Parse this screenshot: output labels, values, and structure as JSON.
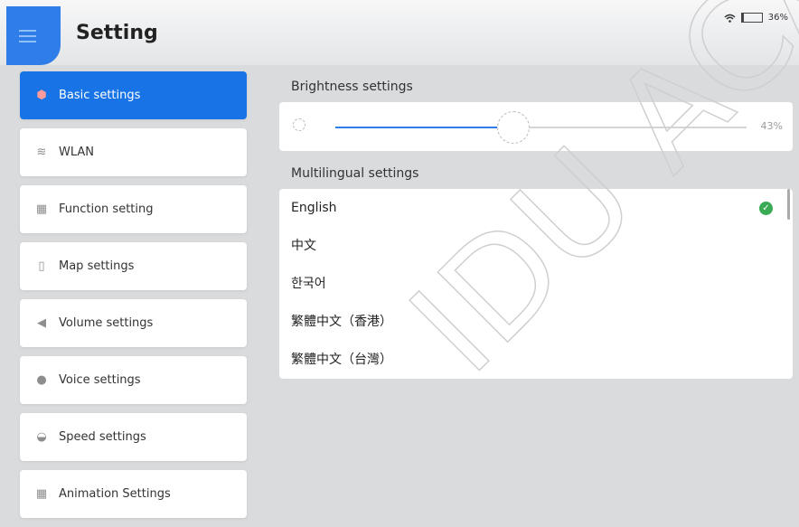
{
  "header": {
    "title": "Setting",
    "battery": "36%"
  },
  "sidebar": {
    "items": [
      {
        "label": "Basic settings",
        "icon": "gear-icon"
      },
      {
        "label": "WLAN",
        "icon": "wifi-icon"
      },
      {
        "label": "Function setting",
        "icon": "grid-icon"
      },
      {
        "label": "Map settings",
        "icon": "map-icon"
      },
      {
        "label": "Volume settings",
        "icon": "volume-icon"
      },
      {
        "label": "Voice settings",
        "icon": "chat-bubble-icon"
      },
      {
        "label": "Speed settings",
        "icon": "speedometer-icon"
      },
      {
        "label": "Animation Settings",
        "icon": "grid-icon"
      }
    ]
  },
  "brightness": {
    "title": "Brightness settings",
    "value": 43,
    "value_label": "43%"
  },
  "language": {
    "title": "Multilingual settings",
    "options": [
      "English",
      "中文",
      "한국어",
      "繁體中文（香港）",
      "繁體中文（台灣）"
    ],
    "selected": "English"
  },
  "colors": {
    "accent": "#1874e6",
    "check": "#3aaa55"
  }
}
